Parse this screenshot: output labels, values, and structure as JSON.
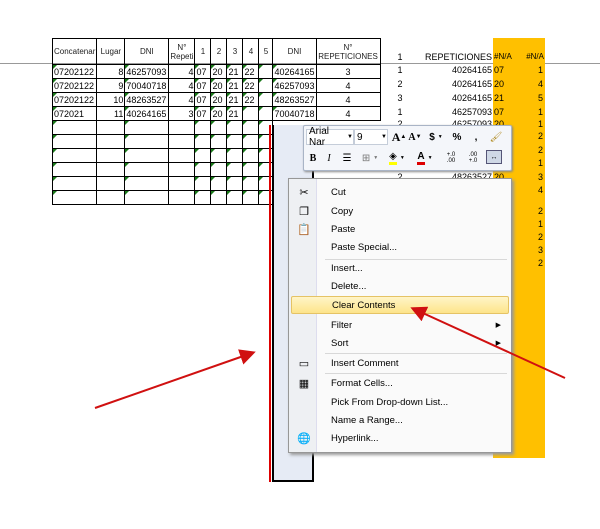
{
  "headers": [
    "Concatenar",
    "Lugar",
    "DNI",
    "N° Repeti",
    "1",
    "2",
    "3",
    "4",
    "5",
    "DNI",
    "N° REPETICIONES"
  ],
  "rows": [
    [
      "07202122",
      "8",
      "46257093",
      "4",
      "07",
      "20",
      "21",
      "22",
      "",
      "40264165",
      "3"
    ],
    [
      "07202122",
      "9",
      "70040718",
      "4",
      "07",
      "20",
      "21",
      "22",
      "",
      "46257093",
      "4"
    ],
    [
      "07202122",
      "10",
      "48263527",
      "4",
      "07",
      "20",
      "21",
      "22",
      "",
      "48263527",
      "4"
    ],
    [
      "072021",
      "11",
      "40264165",
      "3",
      "07",
      "20",
      "21",
      "",
      "",
      "70040718",
      "4"
    ]
  ],
  "right_headers": {
    "col1": "1",
    "repeticiones": "REPETICIONES",
    "na1": "#N/A",
    "na2": "#N/A"
  },
  "right_rows": [
    {
      "c1": "1",
      "rep": "40264165",
      "na1": "07",
      "na2": "1"
    },
    {
      "c1": "2",
      "rep": "40264165",
      "na1": "20",
      "na2": "4"
    },
    {
      "c1": "3",
      "rep": "40264165",
      "na1": "21",
      "na2": "5"
    },
    {
      "c1": "1",
      "rep": "46257093",
      "na1": "07",
      "na2": "1"
    },
    {
      "c1": "2",
      "rep": "46257093",
      "na1": "20",
      "na2": "1"
    },
    {
      "c1": "",
      "rep": "",
      "na1": "",
      "na2": "2"
    },
    {
      "c1": "",
      "rep": "",
      "na1": "",
      "na2": "2"
    },
    {
      "c1": "",
      "rep": "",
      "na1": "",
      "na2": "1"
    },
    {
      "c1": "2",
      "rep": "48263527",
      "na1": "20",
      "na2": "3"
    },
    {
      "c1": "",
      "rep": "",
      "na1": "",
      "na2": "4"
    }
  ],
  "extra_na2": [
    "2",
    "1",
    "2",
    "3",
    "2"
  ],
  "toolbar": {
    "font": "Arial Nar",
    "size": "9",
    "grow": "A",
    "shrink": "A",
    "currency": "$",
    "percent": "%",
    "comma": ",",
    "bold": "B",
    "italic": "I",
    "inc_dec": "+.0 .00",
    "dec_dec": ".00 +.0"
  },
  "menu": [
    {
      "label": "Cut",
      "icon": "scissors-icon",
      "glyph": "✂"
    },
    {
      "label": "Copy",
      "icon": "copy-icon",
      "glyph": "❐"
    },
    {
      "label": "Paste",
      "icon": "paste-icon",
      "glyph": "📋"
    },
    {
      "label": "Paste Special...",
      "icon": "",
      "glyph": ""
    },
    {
      "label": "Insert...",
      "icon": "",
      "glyph": ""
    },
    {
      "label": "Delete...",
      "icon": "",
      "glyph": ""
    },
    {
      "label": "Clear Contents",
      "icon": "",
      "glyph": "",
      "highlighted": true
    },
    {
      "label": "Filter",
      "icon": "",
      "glyph": "",
      "submenu": true
    },
    {
      "label": "Sort",
      "icon": "",
      "glyph": "",
      "submenu": true
    },
    {
      "label": "Insert Comment",
      "icon": "comment-icon",
      "glyph": "▭"
    },
    {
      "label": "Format Cells...",
      "icon": "format-cells-icon",
      "glyph": "▦"
    },
    {
      "label": "Pick From Drop-down List...",
      "icon": "",
      "glyph": ""
    },
    {
      "label": "Name a Range...",
      "icon": "",
      "glyph": ""
    },
    {
      "label": "Hyperlink...",
      "icon": "hyperlink-icon",
      "glyph": "🌐"
    }
  ],
  "colors": {
    "accent": "#ffc000",
    "arrow": "#d01010",
    "highlight": "#fde48a"
  }
}
